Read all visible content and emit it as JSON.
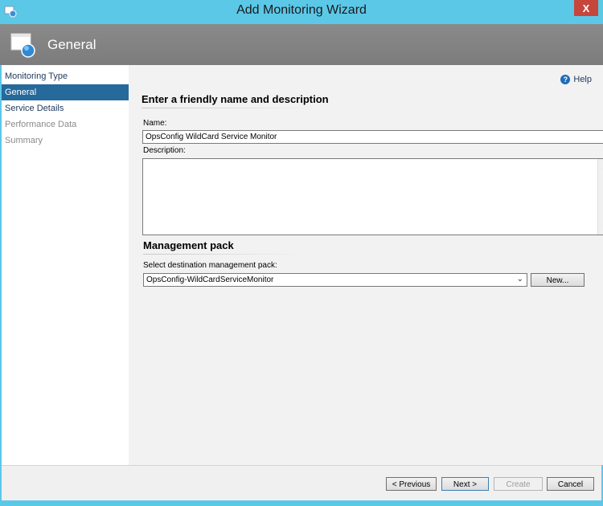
{
  "window": {
    "title": "Add Monitoring Wizard",
    "close_label": "X"
  },
  "header": {
    "title": "General",
    "icon": "wizard-page-icon"
  },
  "nav": {
    "items": [
      {
        "label": "Monitoring Type",
        "state": "normal"
      },
      {
        "label": "General",
        "state": "selected"
      },
      {
        "label": "Service Details",
        "state": "normal"
      },
      {
        "label": "Performance Data",
        "state": "disabled"
      },
      {
        "label": "Summary",
        "state": "disabled"
      }
    ]
  },
  "help": {
    "label": "Help",
    "icon": "help-icon"
  },
  "general_section": {
    "heading": "Enter a friendly name and description",
    "name_label": "Name:",
    "name_value": "OpsConfig WildCard Service Monitor",
    "description_label": "Description:",
    "description_value": ""
  },
  "management_pack": {
    "heading": "Management pack",
    "select_label": "Select destination management pack:",
    "selected_value": "OpsConfig-WildCardServiceMonitor",
    "new_button": "New..."
  },
  "footer": {
    "previous": "< Previous",
    "next": "Next >",
    "create": "Create",
    "cancel": "Cancel"
  },
  "colors": {
    "frame": "#5cc8e8",
    "header_band": "#808080",
    "nav_selected": "#26699b",
    "close_button": "#c7463c"
  }
}
